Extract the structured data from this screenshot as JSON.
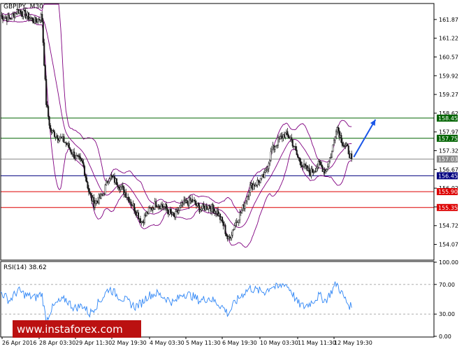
{
  "symbol_label": "GBPJPY, M30",
  "watermark": "www.instaforex.com",
  "colors": {
    "frame": "#000000",
    "candle": "#1a1a1a",
    "bollinger": "#800080",
    "resistance": "#006400",
    "pivot": "#000080",
    "support": "#dd0000",
    "current": "#8a8a8a",
    "arrow": "#1a56e8",
    "rsi": "#2f86f6",
    "rsi_level": "#a0a0a0",
    "watermark_bg": "#bb1111",
    "watermark_text": "#ffffff"
  },
  "chart_data": [
    {
      "type": "candlestick",
      "title": "",
      "y_axis": {
        "side": "right",
        "ticks": [
          "161.87",
          "161.22",
          "160.57",
          "159.92",
          "159.27",
          "158.62",
          "157.97",
          "157.32",
          "156.67",
          "156.02",
          "155.37",
          "154.72",
          "154.07"
        ],
        "ylim": [
          153.55,
          162.4
        ]
      },
      "x_axis": {
        "ticks": [
          "26 Apr 2016",
          "28 Apr 03:30",
          "29 Apr 11:30",
          "2 May 19:30",
          "4 May 03:30",
          "5 May 11:30",
          "6 May 19:30",
          "10 May 03:30",
          "11 May 11:30",
          "12 May 19:30"
        ]
      },
      "horizontal_levels": [
        {
          "label": "158.45",
          "value": 158.45,
          "role": "resistance"
        },
        {
          "label": "157.75",
          "value": 157.75,
          "role": "resistance"
        },
        {
          "label": "157.03",
          "value": 157.03,
          "role": "current"
        },
        {
          "label": "156.45",
          "value": 156.45,
          "role": "pivot"
        },
        {
          "label": "155.90",
          "value": 155.9,
          "role": "support"
        },
        {
          "label": "155.35",
          "value": 155.35,
          "role": "support"
        }
      ],
      "close_path": [
        [
          0,
          162.0
        ],
        [
          0.02,
          161.9
        ],
        [
          0.04,
          162.2
        ],
        [
          0.06,
          162.0
        ],
        [
          0.08,
          161.8
        ],
        [
          0.095,
          162.0
        ],
        [
          0.105,
          159.0
        ],
        [
          0.115,
          158.0
        ],
        [
          0.13,
          157.85
        ],
        [
          0.15,
          157.6
        ],
        [
          0.17,
          157.15
        ],
        [
          0.19,
          156.85
        ],
        [
          0.205,
          155.8
        ],
        [
          0.215,
          155.5
        ],
        [
          0.235,
          155.75
        ],
        [
          0.25,
          156.45
        ],
        [
          0.27,
          156.2
        ],
        [
          0.29,
          155.8
        ],
        [
          0.31,
          155.3
        ],
        [
          0.325,
          154.85
        ],
        [
          0.34,
          155.2
        ],
        [
          0.36,
          155.5
        ],
        [
          0.38,
          155.35
        ],
        [
          0.4,
          155.0
        ],
        [
          0.42,
          155.45
        ],
        [
          0.44,
          155.6
        ],
        [
          0.46,
          155.3
        ],
        [
          0.48,
          155.4
        ],
        [
          0.5,
          155.2
        ],
        [
          0.515,
          154.7
        ],
        [
          0.525,
          154.2
        ],
        [
          0.54,
          154.75
        ],
        [
          0.56,
          155.35
        ],
        [
          0.575,
          156.05
        ],
        [
          0.59,
          156.2
        ],
        [
          0.61,
          156.45
        ],
        [
          0.625,
          157.3
        ],
        [
          0.64,
          157.65
        ],
        [
          0.655,
          157.9
        ],
        [
          0.67,
          157.75
        ],
        [
          0.685,
          157.1
        ],
        [
          0.7,
          156.75
        ],
        [
          0.715,
          156.55
        ],
        [
          0.735,
          156.85
        ],
        [
          0.75,
          156.6
        ],
        [
          0.765,
          157.3
        ],
        [
          0.775,
          158.2
        ],
        [
          0.79,
          157.55
        ],
        [
          0.8,
          157.4
        ],
        [
          0.81,
          157.03
        ]
      ],
      "bollinger_bands": {
        "period": 20,
        "deviations": 2
      },
      "forecast_arrow": {
        "from": [
          0.815,
          157.1
        ],
        "to": [
          0.865,
          158.4
        ]
      }
    },
    {
      "type": "line",
      "indicator_label": "RSI(14) 38.62",
      "value": 38.62,
      "y_axis": {
        "ticks": [
          "100.00",
          "70.00",
          "30.00",
          "0.00"
        ],
        "ylim": [
          0,
          100
        ],
        "levels": [
          70,
          30
        ]
      },
      "series": [
        {
          "x": [
            0,
            0.02,
            0.04,
            0.06,
            0.08,
            0.095,
            0.105,
            0.115,
            0.13,
            0.15,
            0.17,
            0.19,
            0.205,
            0.215,
            0.235,
            0.25,
            0.27,
            0.29,
            0.31,
            0.325,
            0.34,
            0.36,
            0.38,
            0.4,
            0.42,
            0.44,
            0.46,
            0.48,
            0.5,
            0.515,
            0.525,
            0.54,
            0.56,
            0.575,
            0.59,
            0.61,
            0.625,
            0.64,
            0.655,
            0.67,
            0.685,
            0.7,
            0.715,
            0.735,
            0.75,
            0.765,
            0.775,
            0.79,
            0.8,
            0.81
          ],
          "y": [
            60,
            48,
            62,
            55,
            52,
            58,
            20,
            35,
            45,
            50,
            38,
            42,
            30,
            38,
            52,
            65,
            55,
            48,
            40,
            45,
            55,
            58,
            52,
            45,
            58,
            55,
            48,
            52,
            45,
            38,
            30,
            45,
            58,
            65,
            62,
            60,
            68,
            65,
            72,
            62,
            45,
            40,
            45,
            55,
            48,
            62,
            72,
            55,
            45,
            38.62
          ]
        }
      ]
    }
  ]
}
